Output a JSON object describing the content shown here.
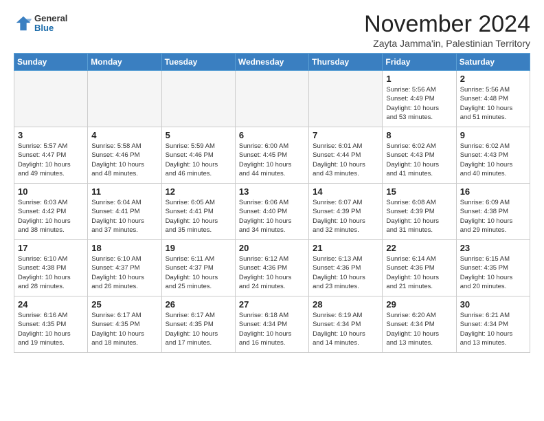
{
  "header": {
    "logo": {
      "general": "General",
      "blue": "Blue"
    },
    "title": "November 2024",
    "location": "Zayta Jamma'in, Palestinian Territory"
  },
  "calendar": {
    "weekdays": [
      "Sunday",
      "Monday",
      "Tuesday",
      "Wednesday",
      "Thursday",
      "Friday",
      "Saturday"
    ],
    "weeks": [
      [
        {
          "day": "",
          "info": ""
        },
        {
          "day": "",
          "info": ""
        },
        {
          "day": "",
          "info": ""
        },
        {
          "day": "",
          "info": ""
        },
        {
          "day": "",
          "info": ""
        },
        {
          "day": "1",
          "info": "Sunrise: 5:56 AM\nSunset: 4:49 PM\nDaylight: 10 hours\nand 53 minutes."
        },
        {
          "day": "2",
          "info": "Sunrise: 5:56 AM\nSunset: 4:48 PM\nDaylight: 10 hours\nand 51 minutes."
        }
      ],
      [
        {
          "day": "3",
          "info": "Sunrise: 5:57 AM\nSunset: 4:47 PM\nDaylight: 10 hours\nand 49 minutes."
        },
        {
          "day": "4",
          "info": "Sunrise: 5:58 AM\nSunset: 4:46 PM\nDaylight: 10 hours\nand 48 minutes."
        },
        {
          "day": "5",
          "info": "Sunrise: 5:59 AM\nSunset: 4:46 PM\nDaylight: 10 hours\nand 46 minutes."
        },
        {
          "day": "6",
          "info": "Sunrise: 6:00 AM\nSunset: 4:45 PM\nDaylight: 10 hours\nand 44 minutes."
        },
        {
          "day": "7",
          "info": "Sunrise: 6:01 AM\nSunset: 4:44 PM\nDaylight: 10 hours\nand 43 minutes."
        },
        {
          "day": "8",
          "info": "Sunrise: 6:02 AM\nSunset: 4:43 PM\nDaylight: 10 hours\nand 41 minutes."
        },
        {
          "day": "9",
          "info": "Sunrise: 6:02 AM\nSunset: 4:43 PM\nDaylight: 10 hours\nand 40 minutes."
        }
      ],
      [
        {
          "day": "10",
          "info": "Sunrise: 6:03 AM\nSunset: 4:42 PM\nDaylight: 10 hours\nand 38 minutes."
        },
        {
          "day": "11",
          "info": "Sunrise: 6:04 AM\nSunset: 4:41 PM\nDaylight: 10 hours\nand 37 minutes."
        },
        {
          "day": "12",
          "info": "Sunrise: 6:05 AM\nSunset: 4:41 PM\nDaylight: 10 hours\nand 35 minutes."
        },
        {
          "day": "13",
          "info": "Sunrise: 6:06 AM\nSunset: 4:40 PM\nDaylight: 10 hours\nand 34 minutes."
        },
        {
          "day": "14",
          "info": "Sunrise: 6:07 AM\nSunset: 4:39 PM\nDaylight: 10 hours\nand 32 minutes."
        },
        {
          "day": "15",
          "info": "Sunrise: 6:08 AM\nSunset: 4:39 PM\nDaylight: 10 hours\nand 31 minutes."
        },
        {
          "day": "16",
          "info": "Sunrise: 6:09 AM\nSunset: 4:38 PM\nDaylight: 10 hours\nand 29 minutes."
        }
      ],
      [
        {
          "day": "17",
          "info": "Sunrise: 6:10 AM\nSunset: 4:38 PM\nDaylight: 10 hours\nand 28 minutes."
        },
        {
          "day": "18",
          "info": "Sunrise: 6:10 AM\nSunset: 4:37 PM\nDaylight: 10 hours\nand 26 minutes."
        },
        {
          "day": "19",
          "info": "Sunrise: 6:11 AM\nSunset: 4:37 PM\nDaylight: 10 hours\nand 25 minutes."
        },
        {
          "day": "20",
          "info": "Sunrise: 6:12 AM\nSunset: 4:36 PM\nDaylight: 10 hours\nand 24 minutes."
        },
        {
          "day": "21",
          "info": "Sunrise: 6:13 AM\nSunset: 4:36 PM\nDaylight: 10 hours\nand 23 minutes."
        },
        {
          "day": "22",
          "info": "Sunrise: 6:14 AM\nSunset: 4:36 PM\nDaylight: 10 hours\nand 21 minutes."
        },
        {
          "day": "23",
          "info": "Sunrise: 6:15 AM\nSunset: 4:35 PM\nDaylight: 10 hours\nand 20 minutes."
        }
      ],
      [
        {
          "day": "24",
          "info": "Sunrise: 6:16 AM\nSunset: 4:35 PM\nDaylight: 10 hours\nand 19 minutes."
        },
        {
          "day": "25",
          "info": "Sunrise: 6:17 AM\nSunset: 4:35 PM\nDaylight: 10 hours\nand 18 minutes."
        },
        {
          "day": "26",
          "info": "Sunrise: 6:17 AM\nSunset: 4:35 PM\nDaylight: 10 hours\nand 17 minutes."
        },
        {
          "day": "27",
          "info": "Sunrise: 6:18 AM\nSunset: 4:34 PM\nDaylight: 10 hours\nand 16 minutes."
        },
        {
          "day": "28",
          "info": "Sunrise: 6:19 AM\nSunset: 4:34 PM\nDaylight: 10 hours\nand 14 minutes."
        },
        {
          "day": "29",
          "info": "Sunrise: 6:20 AM\nSunset: 4:34 PM\nDaylight: 10 hours\nand 13 minutes."
        },
        {
          "day": "30",
          "info": "Sunrise: 6:21 AM\nSunset: 4:34 PM\nDaylight: 10 hours\nand 13 minutes."
        }
      ]
    ]
  }
}
